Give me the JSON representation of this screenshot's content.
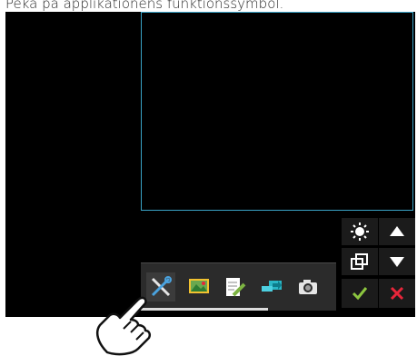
{
  "instruction": "Peka på applikationens funktionssymbol.",
  "colors": {
    "screen_bg": "#000000",
    "preview_border": "#3aa3c6",
    "toolbar_bg": "#2b2b2b",
    "ok_green": "#8cc63f",
    "cancel_red": "#e8263a"
  },
  "icons": {
    "side": [
      "brightness-icon",
      "window-switch-icon",
      "arrow-up-icon",
      "arrow-down-icon",
      "ok-check-icon",
      "cancel-x-icon"
    ],
    "toolbar": [
      "tools-icon",
      "image-viewer-icon",
      "note-edit-icon",
      "transfer-icon",
      "camera-icon"
    ]
  },
  "toolbar": {
    "active_tool": "tools-icon",
    "scroll_progress": 0.65
  }
}
